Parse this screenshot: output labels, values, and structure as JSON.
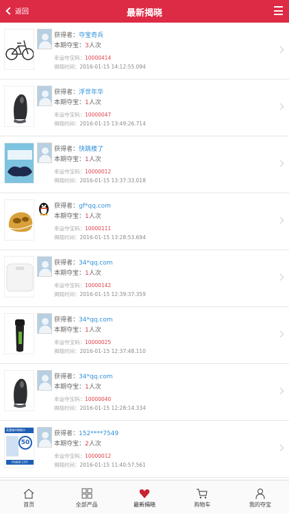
{
  "header": {
    "back_label": "返回",
    "title": "最新揭晓"
  },
  "labels": {
    "winner": "获得者：",
    "issue": "本期夺宝：",
    "lucky_code": "幸运夺宝码：",
    "time": "揭晓时间："
  },
  "items": [
    {
      "product": "folding-bike",
      "winner": "夺宝奇兵",
      "count": "3",
      "unit": "人次",
      "code": "10000414",
      "time": "2016-01-15 14:12:55.094",
      "qq": false
    },
    {
      "product": "mouse",
      "winner": "浮世年华",
      "count": "1",
      "unit": "人次",
      "code": "10000047",
      "time": "2016-01-15 13:49:26.714",
      "qq": false
    },
    {
      "product": "massage-pillow",
      "winner": "快跳楼了",
      "count": "1",
      "unit": "人次",
      "code": "10000012",
      "time": "2016-01-15 13:37:33.018",
      "qq": false
    },
    {
      "product": "foot-massager",
      "winner": "gf*qq.com",
      "count": "1",
      "unit": "人次",
      "code": "10000111",
      "time": "2016-01-15 13:28:53.694",
      "qq": true
    },
    {
      "product": "scale",
      "winner": "34*qq.com",
      "count": "1",
      "unit": "人次",
      "code": "10000142",
      "time": "2016-01-15 12:39:37.359",
      "qq": false
    },
    {
      "product": "shaver",
      "winner": "34*qq.com",
      "count": "1",
      "unit": "人次",
      "code": "10000025",
      "time": "2016-01-15 12:37:48.110",
      "qq": false
    },
    {
      "product": "mouse",
      "winner": "34*qq.com",
      "count": "1",
      "unit": "人次",
      "code": "10000040",
      "time": "2016-01-15 12:28:14.334",
      "qq": false
    },
    {
      "product": "gift-card",
      "winner": "152****7549",
      "count": "2",
      "unit": "人次",
      "code": "10000012",
      "time": "2016-01-15 11:40:57.561",
      "qq": false,
      "card_title": "芙蓉城市购物卡",
      "card_value": "50",
      "card_brand": "POKER CITY"
    }
  ],
  "tabs": [
    {
      "label": "首页",
      "icon": "home-icon"
    },
    {
      "label": "全部产品",
      "icon": "grid-icon"
    },
    {
      "label": "最新揭晓",
      "icon": "heart-icon"
    },
    {
      "label": "购物车",
      "icon": "cart-icon"
    },
    {
      "label": "我的夺宝",
      "icon": "user-icon"
    }
  ],
  "colors": {
    "brand": "#dd2a45",
    "link": "#2f8fd8",
    "highlight": "#e04048"
  }
}
